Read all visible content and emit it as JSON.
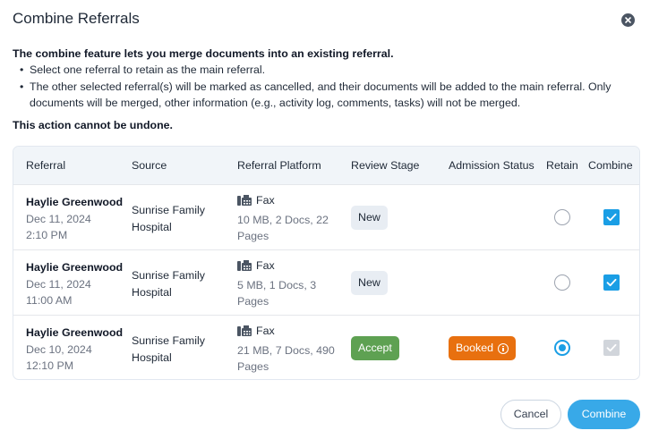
{
  "dialog": {
    "title": "Combine Referrals",
    "intro": "The combine feature lets you merge documents into an existing referral.",
    "bullets": [
      "Select one referral to retain as the main referral.",
      "The other selected referral(s) will be marked as cancelled, and their documents will be added to the main referral. Only documents will be merged, other information (e.g., activity log, comments, tasks) will not be merged."
    ],
    "warning": "This action cannot be undone."
  },
  "table": {
    "headers": {
      "referral": "Referral",
      "source": "Source",
      "platform": "Referral Platform",
      "review_stage": "Review Stage",
      "admission_status": "Admission Status",
      "retain": "Retain",
      "combine": "Combine"
    },
    "rows": [
      {
        "name": "Haylie Greenwood",
        "date": "Dec 11, 2024",
        "time": "2:10 PM",
        "source_line1": "Sunrise Family",
        "source_line2": "Hospital",
        "platform": "Fax",
        "details_line1": "10 MB, 2 Docs, 22",
        "details_line2": "Pages",
        "review_stage": "New",
        "admission_status": "",
        "retain": false,
        "combine": true,
        "combine_disabled": false
      },
      {
        "name": "Haylie Greenwood",
        "date": "Dec 11, 2024",
        "time": "11:00 AM",
        "source_line1": "Sunrise Family",
        "source_line2": "Hospital",
        "platform": "Fax",
        "details_line1": "5 MB, 1 Docs, 3",
        "details_line2": "Pages",
        "review_stage": "New",
        "admission_status": "",
        "retain": false,
        "combine": true,
        "combine_disabled": false
      },
      {
        "name": "Haylie Greenwood",
        "date": "Dec 10, 2024",
        "time": "12:10 PM",
        "source_line1": "Sunrise Family",
        "source_line2": "Hospital",
        "platform": "Fax",
        "details_line1": "21 MB, 7 Docs, 490",
        "details_line2": "Pages",
        "review_stage": "Accept",
        "admission_status": "Booked",
        "retain": true,
        "combine": true,
        "combine_disabled": true
      }
    ]
  },
  "footer": {
    "cancel_label": "Cancel",
    "combine_label": "Combine"
  },
  "icons": {
    "close": "close-circle-icon",
    "platform": "fax-icon",
    "booked_info": "info-icon",
    "checkbox_check": "check-icon"
  },
  "colors": {
    "primary": "#1a9ee5",
    "combine_button": "#38a9e8",
    "accept": "#5ea152",
    "booked": "#e8700f",
    "new_badge": "#e8edf3",
    "header_bg": "#f1f5f9"
  }
}
